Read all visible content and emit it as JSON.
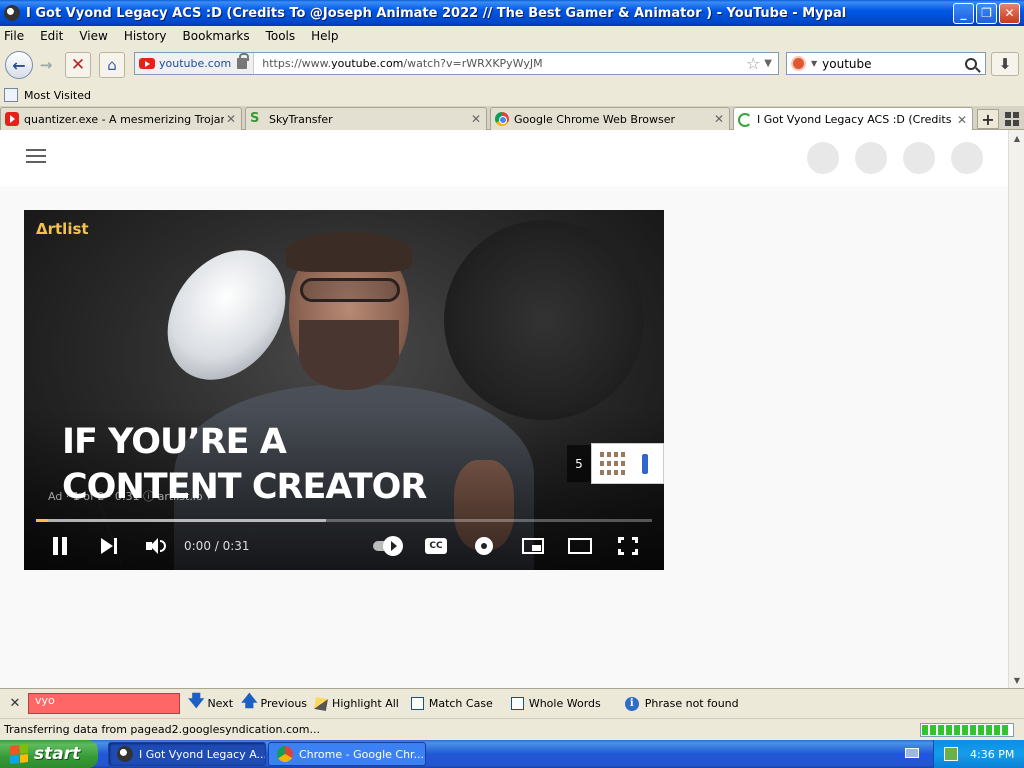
{
  "window": {
    "title": "I Got Vyond Legacy ACS :D (Credits To @Joseph Animate 2022 // The Best Gamer & Animator ) - YouTube - Mypal",
    "minimize": "_",
    "restore": "❐",
    "close": "✕"
  },
  "menu": [
    "File",
    "Edit",
    "View",
    "History",
    "Bookmarks",
    "Tools",
    "Help"
  ],
  "nav": {
    "back": "←",
    "forward": "→",
    "stop": "✕",
    "home": "⌂",
    "site_identity": "youtube.com",
    "url_prefix": "https://www.",
    "url_domain": "youtube.com",
    "url_rest": "/watch?v=rWRXKPyWyJM",
    "bookmark_star": "☆",
    "url_dropdown": "▼",
    "search_value": "youtube",
    "search_dropdown": "▼",
    "download": "⬇"
  },
  "bookmarks": {
    "most_visited": "Most Visited"
  },
  "tabs": [
    {
      "label": "quantizer.exe - A mesmerizing Trojan h...",
      "close": "✕"
    },
    {
      "label": "SkyTransfer",
      "close": "✕"
    },
    {
      "label": "Google Chrome Web Browser",
      "close": "✕"
    },
    {
      "label": "I Got Vyond Legacy ACS :D (Credits To ...",
      "close": "✕"
    }
  ],
  "new_tab": "+",
  "player": {
    "brand": "Δrtlist",
    "overlay_line1": "IF YOU’RE A",
    "overlay_line2": "CONTENT CREATOR",
    "ad_info": "Ad · 1 of 2 · 0:31 ⓘ  artlist.io ↗",
    "skip_countdown": "5",
    "time": "0:00 / 0:31",
    "progress_played": 0.02,
    "progress_buffered": 0.47,
    "cc": "CC"
  },
  "findbar": {
    "close": "✕",
    "query": "vyo",
    "next": "Next",
    "previous": "Previous",
    "highlight_all": "Highlight All",
    "match_case": "Match Case",
    "whole_words": "Whole Words",
    "status": "Phrase not found",
    "next_arrow": "🡇",
    "prev_arrow": "🡅",
    "info": "i"
  },
  "statusbar": {
    "text": "Transferring data from pagead2.googlesyndication.com...",
    "progress": 1.0
  },
  "taskbar": {
    "start": "start",
    "items": [
      {
        "label": "I Got Vyond Legacy A..."
      },
      {
        "label": "Chrome - Google Chr..."
      }
    ],
    "clock": "4:36 PM"
  },
  "colors": {
    "find_not_found": "#ff6666",
    "progress_played": "#f2c14e",
    "titlebar_blue": "#0058e6"
  }
}
